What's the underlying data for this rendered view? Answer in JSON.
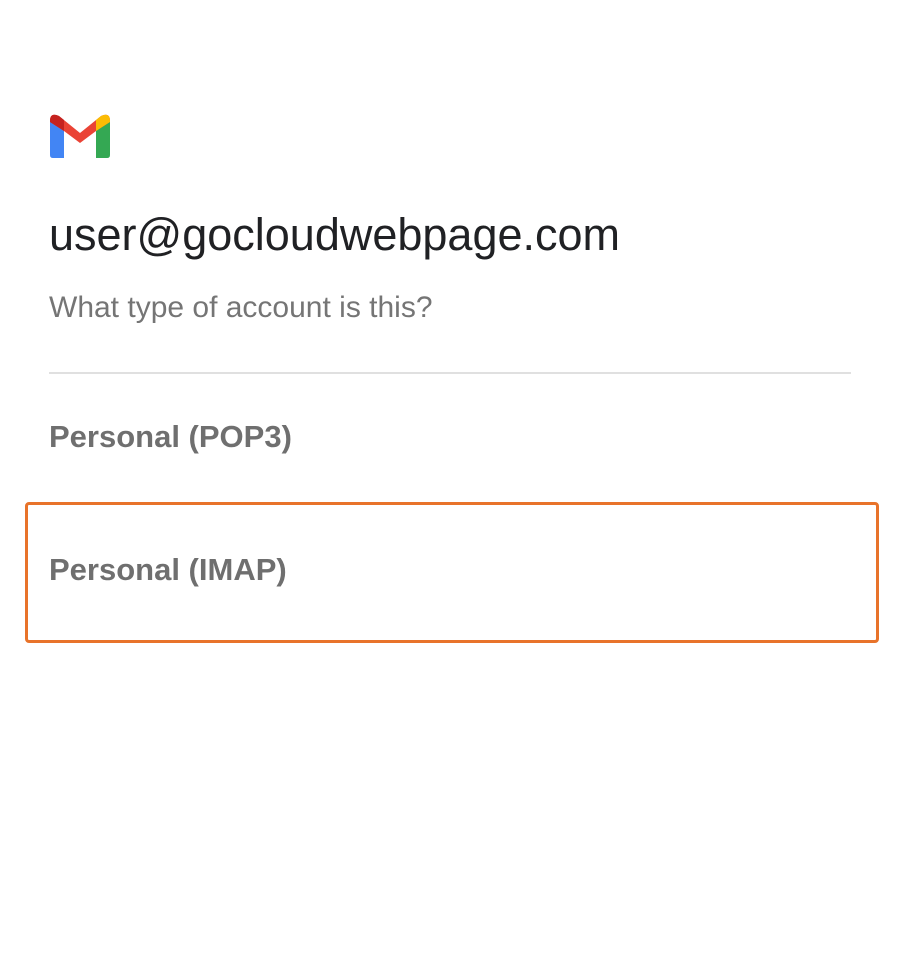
{
  "app": {
    "logo_icon": "gmail-logo-icon"
  },
  "header": {
    "email": "user@gocloudwebpage.com",
    "question": "What type of account is this?"
  },
  "options": [
    {
      "label": "Personal (POP3)",
      "selected": false
    },
    {
      "label": "Personal (IMAP)",
      "selected": true
    }
  ],
  "colors": {
    "highlight": "#e8732a",
    "text_primary": "#202124",
    "text_secondary": "#757575",
    "divider": "#e0e0e0"
  }
}
